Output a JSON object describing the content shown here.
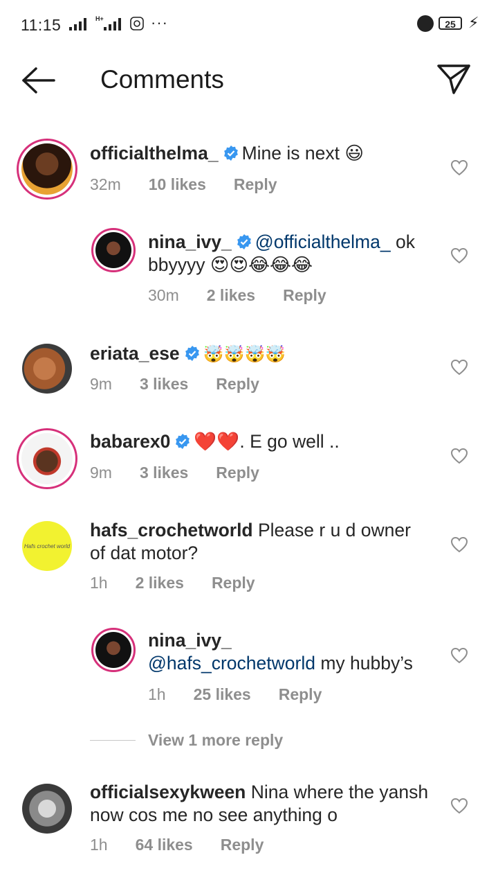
{
  "status_bar": {
    "time": "11:15",
    "network_label": "H+",
    "dots": "···",
    "battery": "25"
  },
  "header": {
    "title": "Comments",
    "back_icon": "arrow-left-icon",
    "send_icon": "paper-plane-icon"
  },
  "comments": [
    {
      "user": "officialthelma_",
      "verified": true,
      "text": "Mine is next 😃",
      "time": "32m",
      "likes": "10 likes",
      "reply": "Reply"
    },
    {
      "user": "nina_ivy_",
      "verified": true,
      "mention": "@officialthelma_",
      "text_line1": " ok",
      "text_line2": "bbyyyy 😍😍😂😂😂",
      "time": "30m",
      "likes": "2 likes",
      "reply": "Reply"
    },
    {
      "user": "eriata_ese",
      "verified": true,
      "text": "🤯🤯🤯🤯",
      "time": "9m",
      "likes": "3 likes",
      "reply": "Reply"
    },
    {
      "user": "babarex0",
      "verified": true,
      "text": "❤️❤️. E go well ..",
      "time": "9m",
      "likes": "3 likes",
      "reply": "Reply"
    },
    {
      "user": "hafs_crochetworld",
      "verified": false,
      "avatar_text": "Hafs crochet world",
      "text_line1": " Please r u d owner",
      "text_line2": "of dat motor?",
      "time": "1h",
      "likes": "2 likes",
      "reply": "Reply"
    },
    {
      "user": "nina_ivy_",
      "verified": false,
      "mention": "@hafs_crochetworld",
      "text": " my hubby’s",
      "time": "1h",
      "likes": "25 likes",
      "reply": "Reply"
    },
    {
      "user": "officialsexykween",
      "verified": false,
      "text_line1": " Nina where the yansh",
      "text_line2": "now cos me no see anything o",
      "time": "1h",
      "likes": "64 likes",
      "reply": "Reply"
    }
  ],
  "view_more": "View 1 more reply",
  "colors": {
    "verified": "#3897f0",
    "mention": "#00376b",
    "meta": "#8e8e8e",
    "story_ring": "#d6307a"
  }
}
